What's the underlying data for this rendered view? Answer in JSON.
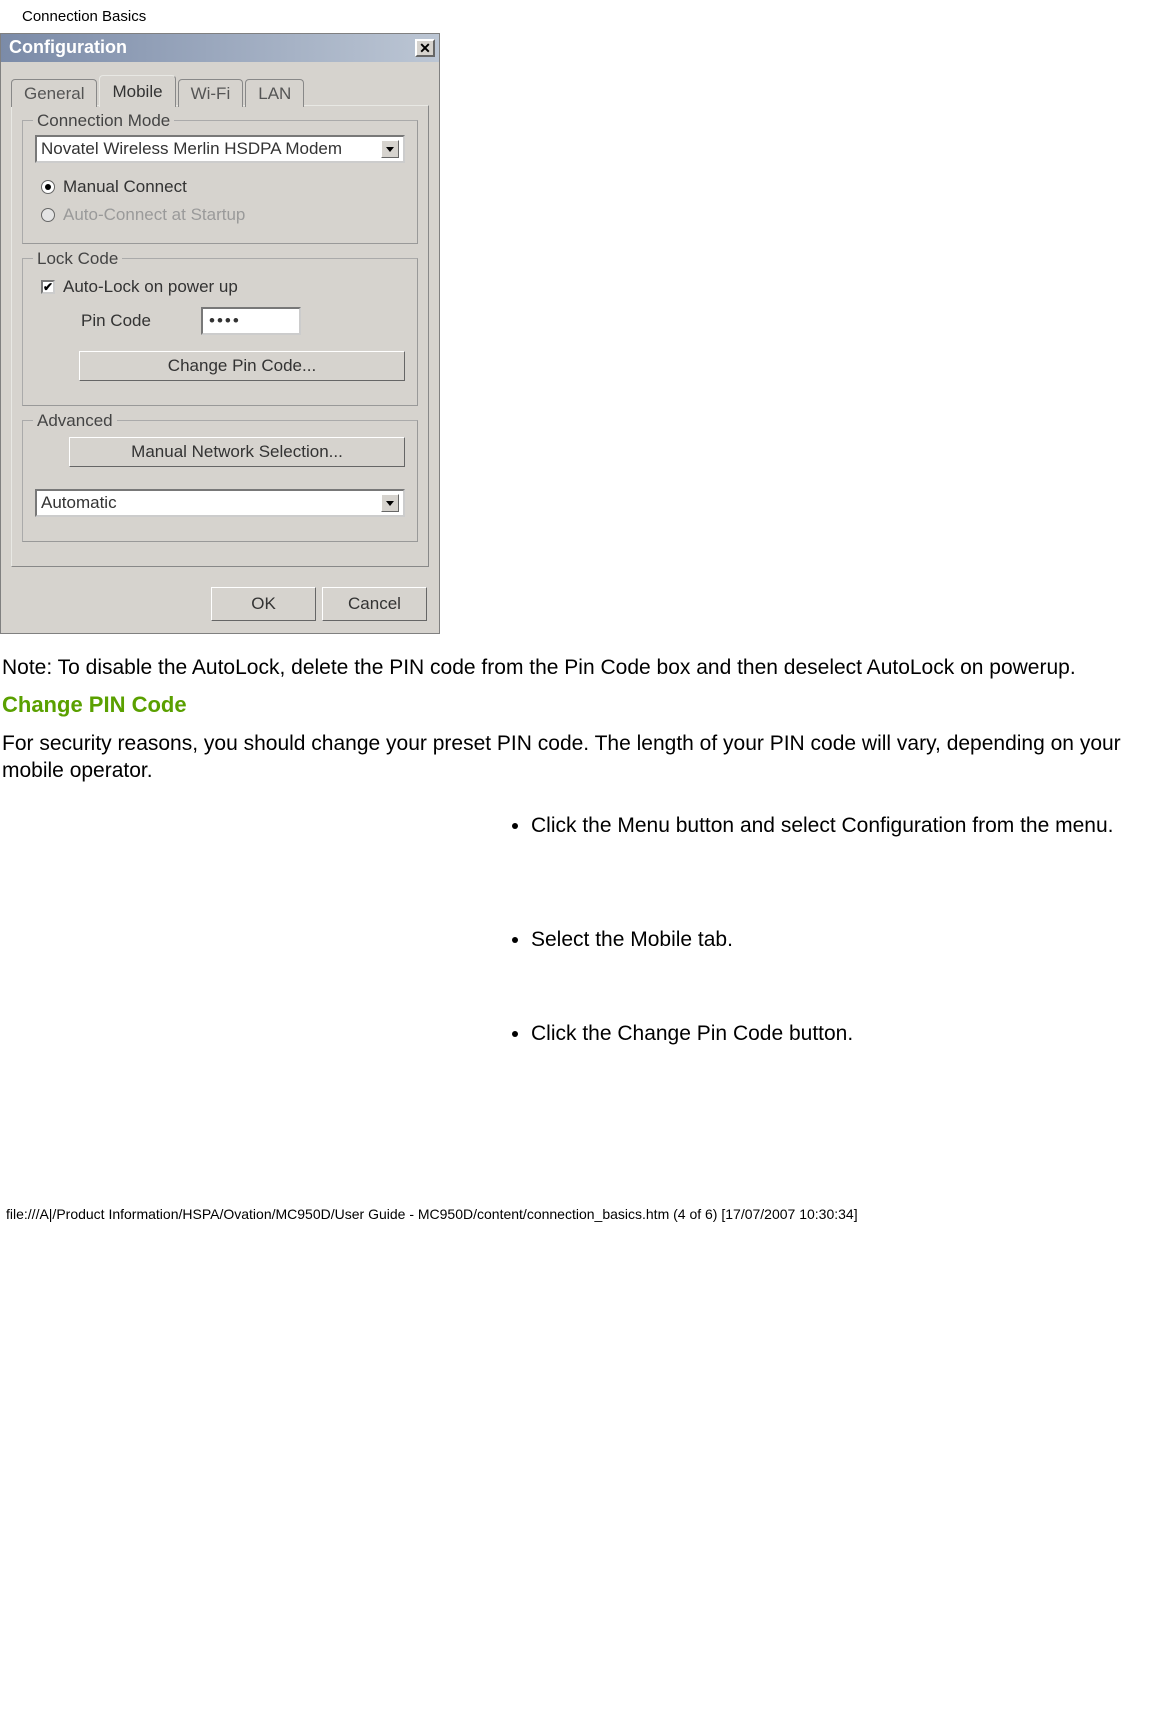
{
  "page_header": "Connection Basics",
  "dialog": {
    "title": "Configuration",
    "tabs": [
      "General",
      "Mobile",
      "Wi-Fi",
      "LAN"
    ],
    "active_tab_index": 1,
    "connection_mode": {
      "legend": "Connection Mode",
      "modem_selected": "Novatel Wireless Merlin HSDPA Modem",
      "radio_manual": "Manual Connect",
      "radio_auto": "Auto-Connect at Startup"
    },
    "lock_code": {
      "legend": "Lock Code",
      "autolock_label": "Auto-Lock on power up",
      "pin_label": "Pin Code",
      "pin_value": "••••",
      "change_pin_btn": "Change Pin Code..."
    },
    "advanced": {
      "legend": "Advanced",
      "manual_net_btn": "Manual Network Selection...",
      "mode_selected": "Automatic"
    },
    "ok_btn": "OK",
    "cancel_btn": "Cancel"
  },
  "body": {
    "note": "Note: To disable the AutoLock, delete the PIN code from the Pin Code box and then deselect AutoLock on powerup.",
    "heading": "Change PIN Code",
    "intro": "For security reasons, you should change your preset PIN code. The length of your PIN code will vary, depending on your mobile operator.",
    "steps": [
      "Click the Menu button and select Configuration from the menu.",
      "Select the Mobile tab.",
      "Click the Change Pin Code button."
    ]
  },
  "footer": "file:///A|/Product Information/HSPA/Ovation/MC950D/User Guide - MC950D/content/connection_basics.htm (4 of 6) [17/07/2007 10:30:34]"
}
